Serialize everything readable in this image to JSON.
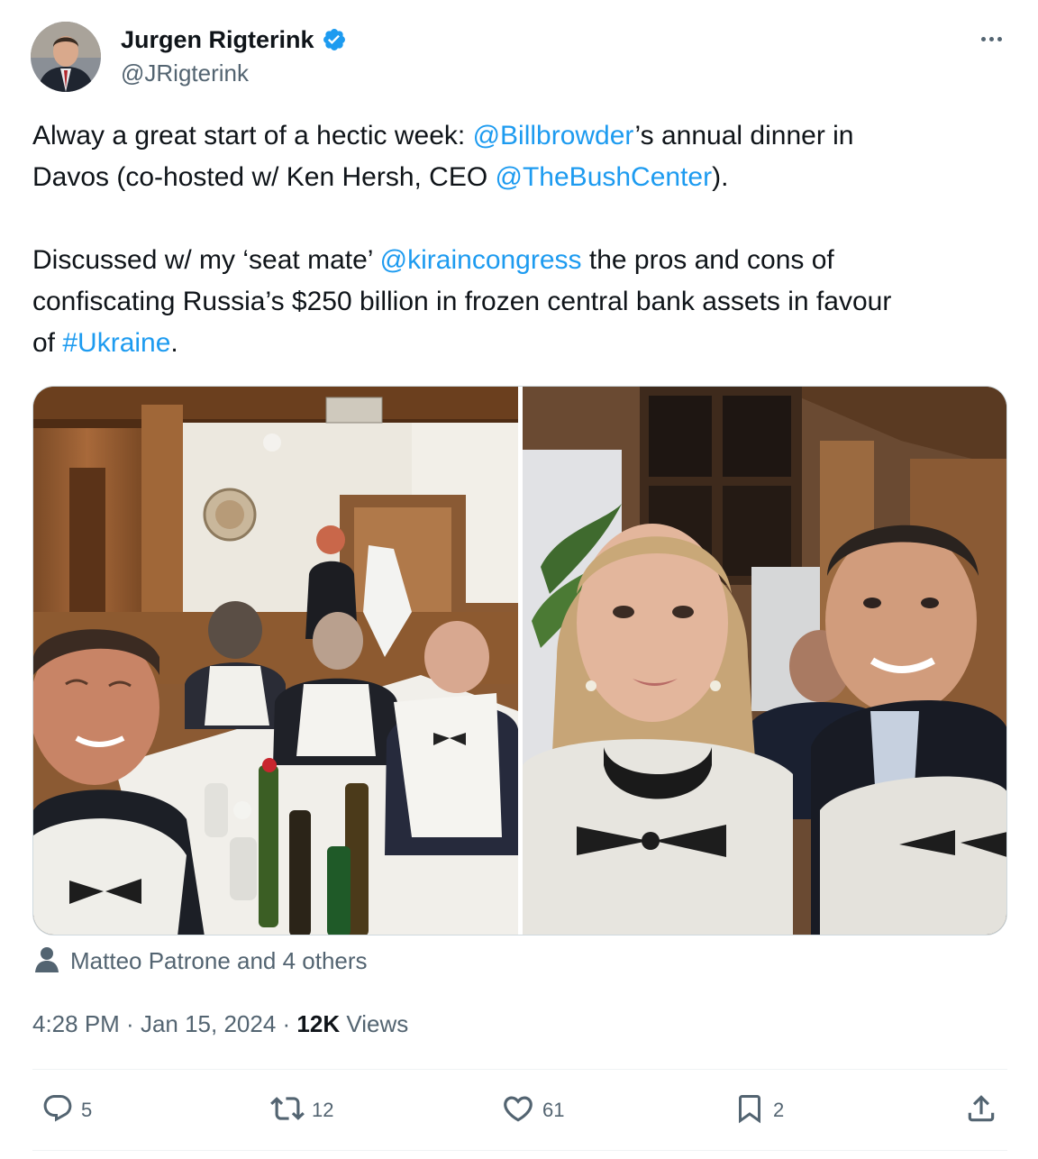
{
  "author": {
    "display_name": "Jurgen Rigterink",
    "handle": "@JRigterink",
    "verified": true
  },
  "tweet": {
    "line1": [
      "Alway a great start of a hectic week: ",
      "@Billbrowder",
      "’s annual dinner in"
    ],
    "line2": [
      "Davos (co-hosted w/ Ken Hersh, CEO ",
      "@TheBushCenter",
      ")."
    ],
    "line3": [
      "Discussed w/ my ‘seat mate’ ",
      "@kiraincongress",
      " the pros and cons of"
    ],
    "line4": "confiscating Russia’s $250 billion in frozen central bank assets in favour",
    "line5": [
      "of ",
      "#Ukraine",
      "."
    ]
  },
  "tagged": "Matteo Patrone and 4 others",
  "meta": {
    "time": "4:28 PM",
    "sep1": " · ",
    "date": "Jan 15, 2024",
    "sep2": " · ",
    "views_count": "12K",
    "views_label": " Views"
  },
  "actions": {
    "replies": "5",
    "reposts": "12",
    "likes": "61",
    "bookmarks": "2"
  },
  "colors": {
    "accent": "#1d9bf0",
    "text": "#0f1419",
    "muted": "#536471",
    "border": "#cfd9de"
  },
  "icons": [
    "verified-badge-icon",
    "more-icon",
    "person-icon",
    "reply-icon",
    "repost-icon",
    "like-icon",
    "bookmark-icon",
    "share-icon"
  ]
}
